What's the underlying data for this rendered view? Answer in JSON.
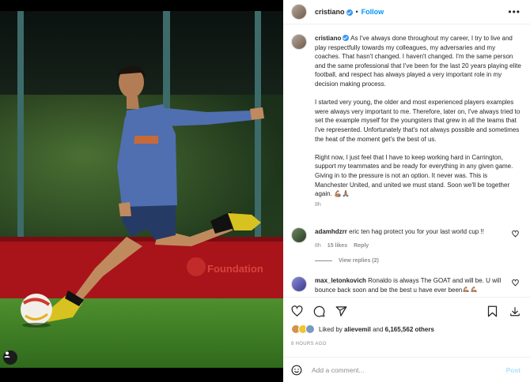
{
  "photo": {
    "alt_icon": "user-tag-icon",
    "banner_brand": "Foundation"
  },
  "header": {
    "username": "cristiano",
    "separator": "•",
    "follow_label": "Follow",
    "more_icon": "more-options-icon"
  },
  "caption": {
    "username": "cristiano",
    "paragraphs": [
      "As I've always done throughout my career, I try to live and play respectfully towards my colleagues, my adversaries and my coaches. That hasn't changed. I haven't changed. I'm the same person and the same professional that I've been for the last 20 years playing elite football, and respect has always played a very important role in my decision making process.",
      "I started very young, the older and most experienced players examples were always very important to me. Therefore, later on, I've always tried to set the example myself for the youngsters that grew in all the teams that I've represented. Unfortunately that's not always possible and sometimes the heat of the moment get's the best of us.",
      "Right now, I just feel that I have to keep working hard in Carrington, support my teammates and be ready for everything in any given game. Giving in to the pressure is not an option. It never was. This is Manchester United, and united we must stand. Soon we'll be together again. 💪🏽🙏🏽"
    ],
    "time": "8h"
  },
  "comments": [
    {
      "username": "adamhdzrr",
      "text": "eric ten hag protect you for your last world cup !!",
      "time": "8h",
      "likes": "15 likes",
      "reply": "Reply",
      "view_replies": "View replies (2)"
    },
    {
      "username": "max_letonkovich",
      "text": "Ronaldo is always The GOAT and will be. U will bounce back soon and be the best u have ever been💪🏽💪🏽"
    }
  ],
  "likes": {
    "liked_by": "Liked by",
    "user": "alievemil",
    "and": "and",
    "count": "6,165,562 others"
  },
  "posted_time": "8 HOURS AGO",
  "add_comment": {
    "placeholder": "Add a comment...",
    "post_label": "Post"
  },
  "colors": {
    "accent": "#0095f6",
    "muted": "#8e8e8e"
  }
}
